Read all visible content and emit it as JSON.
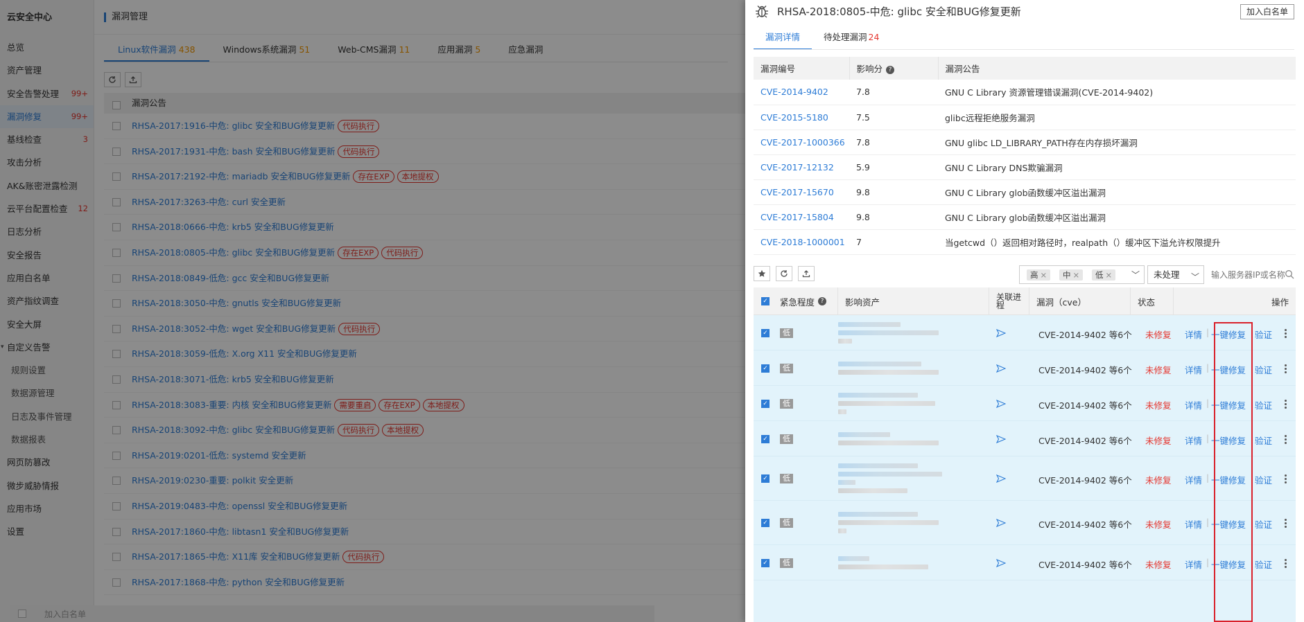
{
  "sidebar": {
    "brand": "云安全中心",
    "items": [
      {
        "label": "总览",
        "badge": ""
      },
      {
        "label": "资产管理",
        "badge": ""
      },
      {
        "label": "安全告警处理",
        "badge": "99+"
      },
      {
        "label": "漏洞修复",
        "badge": "99+",
        "active": true
      },
      {
        "label": "基线检查",
        "badge": "3"
      },
      {
        "label": "攻击分析",
        "badge": ""
      },
      {
        "label": "AK&账密泄露检测",
        "badge": ""
      },
      {
        "label": "云平台配置检查",
        "badge": "12"
      },
      {
        "label": "日志分析",
        "badge": ""
      },
      {
        "label": "安全报告",
        "badge": ""
      },
      {
        "label": "应用白名单",
        "badge": ""
      },
      {
        "label": "资产指纹调查",
        "badge": ""
      },
      {
        "label": "安全大屏",
        "badge": ""
      },
      {
        "label": "自定义告警",
        "badge": "",
        "expanded": true
      },
      {
        "label": "规则设置",
        "badge": "",
        "sub": true
      },
      {
        "label": "数据源管理",
        "badge": "",
        "sub": true
      },
      {
        "label": "日志及事件管理",
        "badge": "",
        "sub": true
      },
      {
        "label": "数据报表",
        "badge": "",
        "sub": true
      },
      {
        "label": "网页防篡改",
        "badge": ""
      },
      {
        "label": "微步威胁情报",
        "badge": ""
      },
      {
        "label": "应用市场",
        "badge": ""
      },
      {
        "label": "设置",
        "badge": ""
      }
    ]
  },
  "main": {
    "title": "漏洞管理",
    "tabs": [
      {
        "label": "Linux软件漏洞",
        "count": "438",
        "active": true
      },
      {
        "label": "Windows系统漏洞",
        "count": "51"
      },
      {
        "label": "Web-CMS漏洞",
        "count": "11"
      },
      {
        "label": "应用漏洞",
        "count": "5"
      },
      {
        "label": "应急漏洞",
        "count": ""
      }
    ],
    "list_header": "漏洞公告",
    "rows": [
      {
        "title": "RHSA-2017:1916-中危: glibc 安全和BUG修复更新",
        "tags": [
          "代码执行"
        ]
      },
      {
        "title": "RHSA-2017:1931-中危: bash 安全和BUG修复更新",
        "tags": [
          "代码执行"
        ]
      },
      {
        "title": "RHSA-2017:2192-中危: mariadb 安全和BUG修复更新",
        "tags": [
          "存在EXP",
          "本地提权"
        ]
      },
      {
        "title": "RHSA-2017:3263-中危: curl 安全更新",
        "tags": []
      },
      {
        "title": "RHSA-2018:0666-中危: krb5 安全和BUG修复更新",
        "tags": []
      },
      {
        "title": "RHSA-2018:0805-中危: glibc 安全和BUG修复更新",
        "tags": [
          "存在EXP",
          "代码执行"
        ]
      },
      {
        "title": "RHSA-2018:0849-低危: gcc 安全和BUG修复更新",
        "tags": []
      },
      {
        "title": "RHSA-2018:3050-中危: gnutls 安全和BUG修复更新",
        "tags": []
      },
      {
        "title": "RHSA-2018:3052-中危: wget 安全和BUG修复更新",
        "tags": [
          "代码执行"
        ]
      },
      {
        "title": "RHSA-2018:3059-低危: X.org X11 安全和BUG修复更新",
        "tags": []
      },
      {
        "title": "RHSA-2018:3071-低危: krb5 安全和BUG修复更新",
        "tags": []
      },
      {
        "title": "RHSA-2018:3083-重要: 内核 安全和BUG修复更新",
        "tags": [
          "需要重启",
          "存在EXP",
          "本地提权"
        ]
      },
      {
        "title": "RHSA-2018:3092-中危: glibc 安全和BUG修复更新",
        "tags": [
          "代码执行",
          "本地提权"
        ]
      },
      {
        "title": "RHSA-2019:0201-低危: systemd 安全更新",
        "tags": []
      },
      {
        "title": "RHSA-2019:0230-重要: polkit 安全更新",
        "tags": []
      },
      {
        "title": "RHSA-2019:0483-中危: openssl 安全和BUG修复更新",
        "tags": []
      },
      {
        "title": "RHSA-2017:1860-中危: libtasn1 安全和BUG修复更新",
        "tags": []
      },
      {
        "title": "RHSA-2017:1865-中危: X11库 安全和BUG修复更新",
        "tags": [
          "代码执行"
        ]
      },
      {
        "title": "RHSA-2017:1868-中危: python 安全和BUG修复更新",
        "tags": []
      }
    ],
    "footer_button": "加入白名单"
  },
  "drawer": {
    "title": "RHSA-2018:0805-中危: glibc 安全和BUG修复更新",
    "whitelist_button": "加入白名单",
    "tabs": [
      {
        "label": "漏洞详情",
        "count": "",
        "active": true
      },
      {
        "label": "待处理漏洞",
        "count": "24"
      }
    ],
    "cve_table": {
      "headers": [
        "漏洞编号",
        "影响分",
        "漏洞公告"
      ],
      "rows": [
        {
          "id": "CVE-2014-9402",
          "score": "7.8",
          "desc": "GNU C Library 资源管理错误漏洞(CVE-2014-9402)"
        },
        {
          "id": "CVE-2015-5180",
          "score": "7.5",
          "desc": "glibc远程拒绝服务漏洞"
        },
        {
          "id": "CVE-2017-1000366",
          "score": "7.8",
          "desc": "GNU glibc LD_LIBRARY_PATH存在内存损坏漏洞"
        },
        {
          "id": "CVE-2017-12132",
          "score": "5.9",
          "desc": "GNU C Library DNS欺骗漏洞"
        },
        {
          "id": "CVE-2017-15670",
          "score": "9.8",
          "desc": "GNU C Library glob函数缓冲区溢出漏洞"
        },
        {
          "id": "CVE-2017-15804",
          "score": "9.8",
          "desc": "GNU C Library glob函数缓冲区溢出漏洞"
        },
        {
          "id": "CVE-2018-1000001",
          "score": "7",
          "desc": "当getcwd（）返回相对路径时，realpath（）缓冲区下溢允许权限提升"
        }
      ]
    },
    "filters": {
      "severity_chips": [
        "高",
        "中",
        "低"
      ],
      "status_value": "未处理",
      "search_placeholder": "输入服务器IP或名称"
    },
    "asset_table": {
      "headers": {
        "urgency": "紧急程度",
        "asset": "影响资产",
        "process": "关联进程",
        "cve": "漏洞（cve）",
        "status": "状态",
        "ops": "操作"
      },
      "rows": [
        {
          "severity": "低",
          "cve": "CVE-2014-9402 等6个",
          "status": "未修复"
        },
        {
          "severity": "低",
          "cve": "CVE-2014-9402 等6个",
          "status": "未修复"
        },
        {
          "severity": "低",
          "cve": "CVE-2014-9402 等6个",
          "status": "未修复"
        },
        {
          "severity": "低",
          "cve": "CVE-2014-9402 等6个",
          "status": "未修复"
        },
        {
          "severity": "低",
          "cve": "CVE-2014-9402 等6个",
          "status": "未修复"
        },
        {
          "severity": "低",
          "cve": "CVE-2014-9402 等6个",
          "status": "未修复"
        },
        {
          "severity": "低",
          "cve": "CVE-2014-9402 等6个",
          "status": "未修复"
        }
      ],
      "op_labels": {
        "detail": "详情",
        "fix": "一键修复",
        "verify": "验证"
      }
    }
  },
  "colors": {
    "accent": "#2d7cd6",
    "danger": "#e5362f",
    "warning": "#f39800",
    "highlight_box": "#d9202a"
  }
}
